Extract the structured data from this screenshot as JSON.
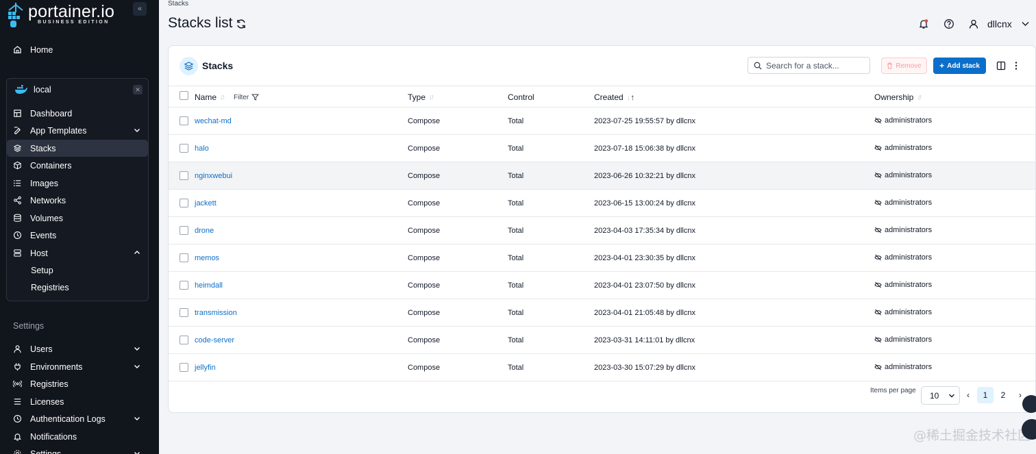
{
  "brand": {
    "name": "portainer.io",
    "edition": "BUSINESS EDITION"
  },
  "sidebar": {
    "home": "Home",
    "environment": "local",
    "env_items": [
      {
        "label": "Dashboard"
      },
      {
        "label": "App Templates"
      },
      {
        "label": "Stacks"
      },
      {
        "label": "Containers"
      },
      {
        "label": "Images"
      },
      {
        "label": "Networks"
      },
      {
        "label": "Volumes"
      },
      {
        "label": "Events"
      },
      {
        "label": "Host"
      }
    ],
    "host_sub": [
      "Setup",
      "Registries"
    ],
    "settings_label": "Settings",
    "settings_items": [
      {
        "label": "Users"
      },
      {
        "label": "Environments"
      },
      {
        "label": "Registries"
      },
      {
        "label": "Licenses"
      },
      {
        "label": "Authentication Logs"
      },
      {
        "label": "Notifications"
      },
      {
        "label": "Settings"
      }
    ]
  },
  "header": {
    "breadcrumb": "Stacks",
    "title": "Stacks list",
    "user": "dllcnx"
  },
  "card": {
    "title": "Stacks",
    "search_placeholder": "Search for a stack...",
    "remove_label": "Remove",
    "add_label": "Add stack"
  },
  "table": {
    "columns": {
      "name": "Name",
      "filter": "Filter",
      "type": "Type",
      "control": "Control",
      "created": "Created",
      "ownership": "Ownership"
    },
    "rows": [
      {
        "name": "wechat-md",
        "type": "Compose",
        "control": "Total",
        "created": "2023-07-25 19:55:57 by dllcnx",
        "ownership": "administrators"
      },
      {
        "name": "halo",
        "type": "Compose",
        "control": "Total",
        "created": "2023-07-18 15:06:38 by dllcnx",
        "ownership": "administrators"
      },
      {
        "name": "nginxwebui",
        "type": "Compose",
        "control": "Total",
        "created": "2023-06-26 10:32:21 by dllcnx",
        "ownership": "administrators"
      },
      {
        "name": "jackett",
        "type": "Compose",
        "control": "Total",
        "created": "2023-06-15 13:00:24 by dllcnx",
        "ownership": "administrators"
      },
      {
        "name": "drone",
        "type": "Compose",
        "control": "Total",
        "created": "2023-04-03 17:35:34 by dllcnx",
        "ownership": "administrators"
      },
      {
        "name": "memos",
        "type": "Compose",
        "control": "Total",
        "created": "2023-04-01 23:30:35 by dllcnx",
        "ownership": "administrators"
      },
      {
        "name": "heimdall",
        "type": "Compose",
        "control": "Total",
        "created": "2023-04-01 23:07:50 by dllcnx",
        "ownership": "administrators"
      },
      {
        "name": "transmission",
        "type": "Compose",
        "control": "Total",
        "created": "2023-04-01 21:05:48 by dllcnx",
        "ownership": "administrators"
      },
      {
        "name": "code-server",
        "type": "Compose",
        "control": "Total",
        "created": "2023-03-31 14:11:01 by dllcnx",
        "ownership": "administrators"
      },
      {
        "name": "jellyfin",
        "type": "Compose",
        "control": "Total",
        "created": "2023-03-30 15:07:29 by dllcnx",
        "ownership": "administrators"
      }
    ]
  },
  "pagination": {
    "items_per_page_label": "Items per page",
    "per_page": "10",
    "prev": "‹",
    "next": "›",
    "pages": [
      "1",
      "2"
    ]
  },
  "watermark": "@稀土掘金技术社区"
}
